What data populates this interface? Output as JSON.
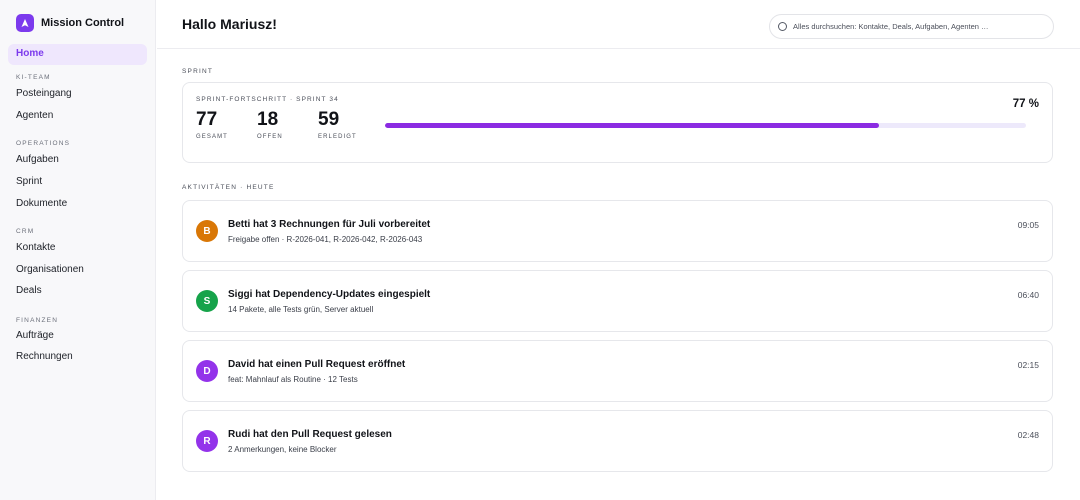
{
  "app": {
    "title": "Mission Control"
  },
  "sidebar": {
    "home_label": "Home",
    "sections": [
      {
        "title": "KI-TEAM",
        "items": [
          "Posteingang",
          "Agenten"
        ]
      },
      {
        "title": "OPERATIONS",
        "items": [
          "Aufgaben",
          "Sprint",
          "Dokumente"
        ]
      },
      {
        "title": "CRM",
        "items": [
          "Kontakte",
          "Organisationen",
          "Deals"
        ]
      },
      {
        "title": "FINANZEN",
        "items": [
          "Aufträge",
          "Rechnungen"
        ]
      }
    ]
  },
  "header": {
    "greeting": "Hallo Mariusz!",
    "search_placeholder": "Alles durchsuchen: Kontakte, Deals, Aufgaben, Agenten …"
  },
  "sprint": {
    "section_label": "SPRINT",
    "card_title": "SPRINT-FORTSCHRITT · SPRINT 34",
    "stats": [
      {
        "value": "77",
        "label": "GESAMT"
      },
      {
        "value": "18",
        "label": "OFFEN"
      },
      {
        "value": "59",
        "label": "ERLEDIGT"
      }
    ],
    "progress_percent": 77,
    "progress_label": "77 %"
  },
  "activities": {
    "section_label": "AKTIVITÄTEN · HEUTE",
    "items": [
      {
        "initial": "B",
        "avatar_color": "#d97706",
        "title": "Betti hat 3 Rechnungen für Juli vorbereitet",
        "subtitle": "Freigabe offen · R-2026-041, R-2026-042, R-2026-043",
        "time": "09:05"
      },
      {
        "initial": "S",
        "avatar_color": "#16a34a",
        "title": "Siggi hat Dependency-Updates eingespielt",
        "subtitle": "14 Pakete, alle Tests grün, Server aktuell",
        "time": "06:40"
      },
      {
        "initial": "D",
        "avatar_color": "#9333ea",
        "title": "David hat einen Pull Request eröffnet",
        "subtitle": "feat: Mahnlauf als Routine · 12 Tests",
        "time": "02:15"
      },
      {
        "initial": "R",
        "avatar_color": "#9333ea",
        "title": "Rudi hat den Pull Request gelesen",
        "subtitle": "2 Anmerkungen, keine Blocker",
        "time": "02:48"
      }
    ]
  },
  "icons": {
    "brand": "rocket-icon",
    "search": "search-icon"
  },
  "colors": {
    "accent": "#7c3aed",
    "progress": "#8b2be2"
  }
}
